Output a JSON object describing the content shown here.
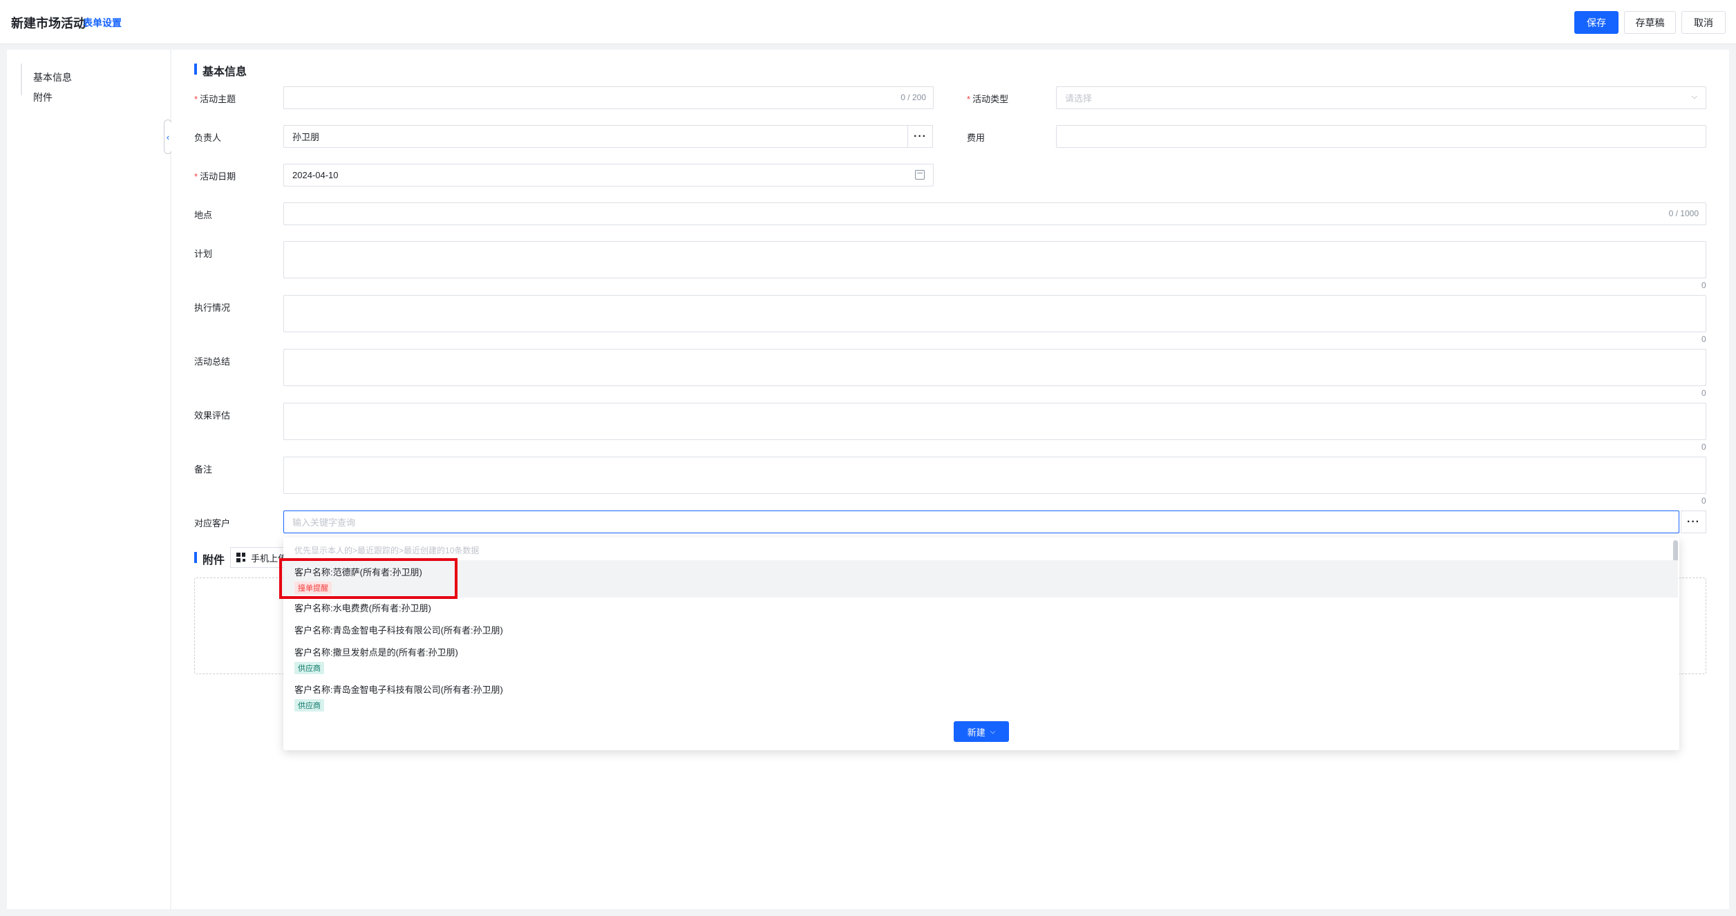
{
  "header": {
    "title": "新建市场活动",
    "settings_link": "表单设置",
    "save": "保存",
    "draft": "存草稿",
    "cancel": "取消"
  },
  "sidenav": {
    "items": [
      {
        "label": "基本信息"
      },
      {
        "label": "附件"
      }
    ]
  },
  "form": {
    "section_basic": "基本信息",
    "topic": {
      "label": "活动主题",
      "counter": "0 / 200"
    },
    "type": {
      "label": "活动类型",
      "placeholder": "请选择"
    },
    "owner": {
      "label": "负责人",
      "value": "孙卫朋"
    },
    "cost": {
      "label": "费用"
    },
    "date": {
      "label": "活动日期",
      "value": "2024-04-10"
    },
    "location": {
      "label": "地点",
      "counter": "0 / 1000"
    },
    "plan": {
      "label": "计划",
      "counter": "0"
    },
    "execution": {
      "label": "执行情况",
      "counter": "0"
    },
    "summary": {
      "label": "活动总结",
      "counter": "0"
    },
    "evaluation": {
      "label": "效果评估",
      "counter": "0"
    },
    "remark": {
      "label": "备注",
      "counter": "0"
    },
    "customer": {
      "label": "对应客户",
      "placeholder": "输入关键字查询"
    },
    "section_attachment": "附件",
    "attach_btn": "手机上传"
  },
  "dropdown": {
    "hint": "优先显示本人的>最近跟踪的>最近创建的10条数据",
    "items": [
      {
        "name": "客户名称:范德萨(所有者:孙卫朋)",
        "tag": "撞单提醒"
      },
      {
        "name": "客户名称:水电费费(所有者:孙卫朋)"
      },
      {
        "name": "客户名称:青岛金智电子科技有限公司(所有者:孙卫朋)"
      },
      {
        "name": "客户名称:撒旦发射点是的(所有者:孙卫朋)",
        "tag": "供应商"
      },
      {
        "name": "客户名称:青岛金智电子科技有限公司(所有者:孙卫朋)",
        "tag": "供应商"
      }
    ],
    "new_btn": "新建"
  },
  "colors": {
    "primary": "#1664ff",
    "required": "#f53f3f",
    "highlight": "#e60012"
  }
}
